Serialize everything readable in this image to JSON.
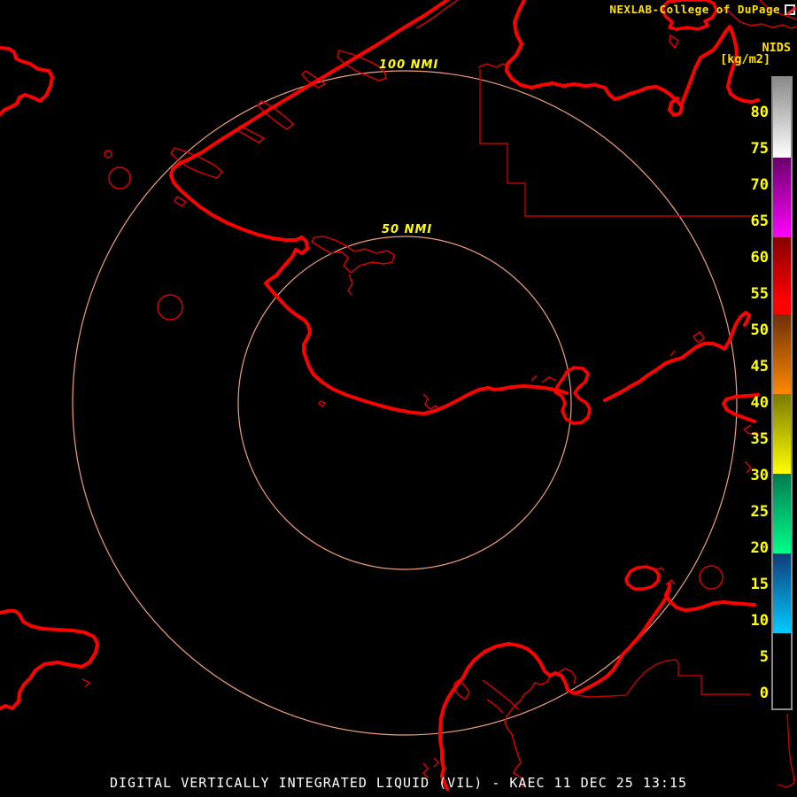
{
  "header": {
    "title": "NEXLAB-College of DuPage",
    "logo_icon": "college-of-dupage-logo"
  },
  "legend": {
    "title": "NIDS",
    "units": "[kg/m2]",
    "ticks": [
      80,
      75,
      70,
      65,
      60,
      55,
      50,
      45,
      40,
      35,
      30,
      25,
      20,
      15,
      10,
      5,
      0
    ],
    "scale_segments": [
      {
        "from": 73,
        "to": 85,
        "colors": [
          "#8a8a8a",
          "#ffffff"
        ],
        "name": "gray-white"
      },
      {
        "from": 62,
        "to": 73,
        "colors": [
          "#6a006a",
          "#ff00ff"
        ],
        "name": "purple-magenta"
      },
      {
        "from": 52,
        "to": 62,
        "colors": [
          "#860000",
          "#ff0000"
        ],
        "name": "dark-red-red"
      },
      {
        "from": 41,
        "to": 52,
        "colors": [
          "#6e3008",
          "#ff8800"
        ],
        "name": "brown-orange"
      },
      {
        "from": 30,
        "to": 41,
        "colors": [
          "#7a7a00",
          "#ffff00"
        ],
        "name": "olive-yellow"
      },
      {
        "from": 19,
        "to": 30,
        "colors": [
          "#007a50",
          "#00ff88"
        ],
        "name": "teal-green"
      },
      {
        "from": 8,
        "to": 19,
        "colors": [
          "#103c78",
          "#00ccff"
        ],
        "name": "blue-cyan"
      },
      {
        "from": 0,
        "to": 8,
        "colors": [
          "#000000",
          "#000000"
        ],
        "name": "black"
      }
    ]
  },
  "rings": [
    {
      "label": "100 NMI",
      "radius_nmi": 100
    },
    {
      "label": "50 NMI",
      "radius_nmi": 50
    }
  ],
  "status_bar": {
    "text": "DIGITAL VERTICALLY INTEGRATED LIQUID (VIL) - KAEC 11 DEC 25 13:15",
    "product": "DIGITAL VERTICALLY INTEGRATED LIQUID (VIL)",
    "station": "KAEC",
    "datetime": "11 DEC 25 13:15"
  },
  "colors": {
    "background": "#000000",
    "coastline": "#ff0000",
    "boundary": "#c00000",
    "range_ring": "#f0a080",
    "label_yellow": "#ffff00",
    "caption_white": "#ffffff",
    "colorbar_border": "#8a8a8a"
  }
}
